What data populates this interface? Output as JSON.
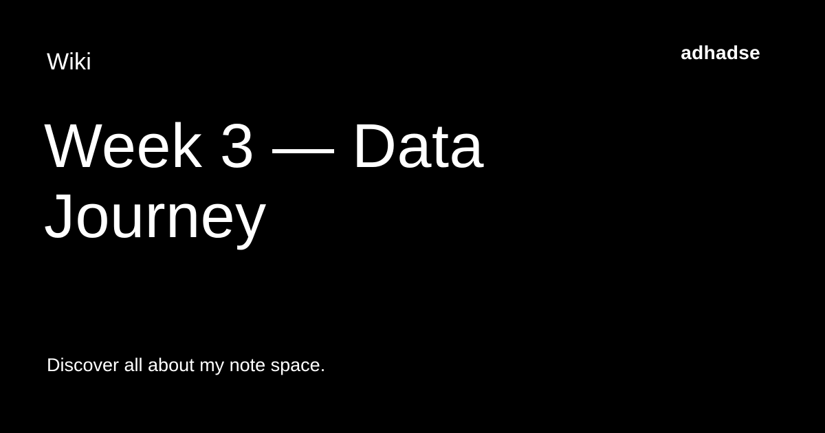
{
  "card": {
    "section": "Wiki",
    "brand": "adhadse",
    "title": "Week 3 — Data Journey",
    "description": "Discover all about my note space.",
    "colors": {
      "background": "#000000",
      "text": "#ffffff"
    }
  }
}
